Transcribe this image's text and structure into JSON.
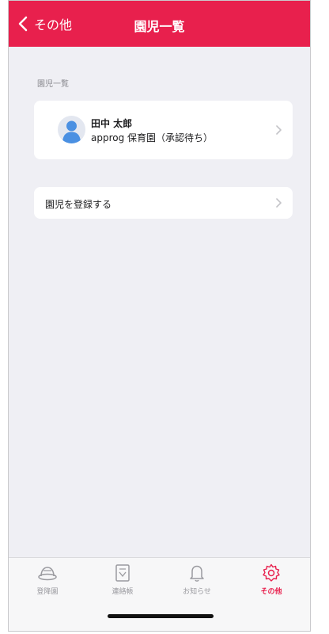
{
  "nav": {
    "back_label": "その他",
    "title": "園児一覧"
  },
  "section": {
    "header": "園児一覧"
  },
  "child": {
    "name": "田中 太郎",
    "school": "approg 保育園（承認待ち）"
  },
  "register": {
    "label": "園児を登録する"
  },
  "tabs": [
    {
      "label": "登降園",
      "icon": "hat-icon"
    },
    {
      "label": "連絡帳",
      "icon": "notebook-icon"
    },
    {
      "label": "お知らせ",
      "icon": "bell-icon"
    },
    {
      "label": "その他",
      "icon": "gear-icon",
      "active": true
    }
  ],
  "colors": {
    "accent": "#e8204d",
    "background": "#efeff4"
  }
}
